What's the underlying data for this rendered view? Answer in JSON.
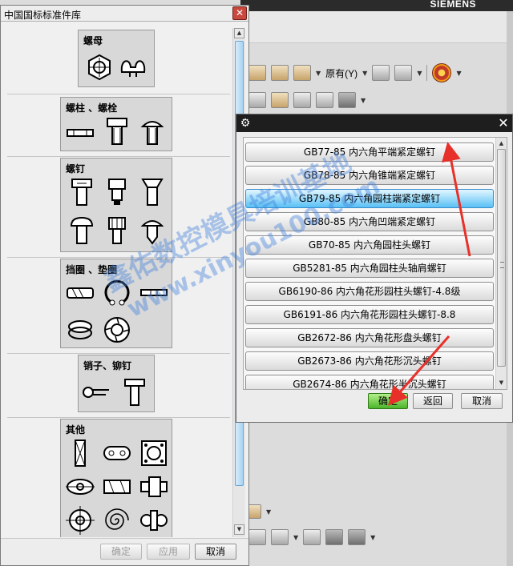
{
  "background": {
    "brand": "SIEMENS",
    "menu_label": "原有(Y)"
  },
  "library_panel": {
    "title": "中国国标标准件库",
    "categories": [
      {
        "label": "螺母",
        "icons": [
          "hex-nut-icon",
          "wing-nut-icon"
        ]
      },
      {
        "label": "螺柱 、螺栓",
        "icons": [
          "stud-icon",
          "hex-bolt-icon",
          "round-head-bolt-icon"
        ]
      },
      {
        "label": "螺钉",
        "icons": [
          "slotted-screw-icon",
          "cheese-head-screw-icon",
          "countersunk-screw-icon",
          "pan-head-screw-icon",
          "knurled-screw-icon",
          "tapping-screw-icon"
        ]
      },
      {
        "label": "挡圈 、垫圈",
        "icons": [
          "retaining-ring-side-icon",
          "circlip-icon",
          "flat-washer-icon",
          "spring-washer-icon",
          "lock-washer-icon"
        ]
      },
      {
        "label": "销子、铆钉",
        "icons": [
          "cotter-pin-icon",
          "rivet-icon"
        ]
      },
      {
        "label": "其他",
        "icons": [
          "key-icon",
          "plate-icon",
          "flange-icon",
          "spacer-icon",
          "clamp-icon",
          "coupling-icon",
          "cross-target-icon",
          "spiral-icon",
          "chain-icon"
        ]
      }
    ],
    "buttons": {
      "ok": "确定",
      "apply": "应用",
      "cancel": "取消"
    }
  },
  "selection_dialog": {
    "items": [
      "GB77-85 内六角平端紧定螺钉",
      "GB78-85 内六角锥端紧定螺钉",
      "GB79-85 内六角园柱端紧定螺钉",
      "GB80-85 内六角凹端紧定螺钉",
      "GB70-85 内六角园柱头螺钉",
      "GB5281-85 内六角园柱头轴肩螺钉",
      "GB6190-86 内六角花形园柱头螺钉-4.8级",
      "GB6191-86 内六角花形园柱头螺钉-8.8",
      "GB2672-86 内六角花形盘头螺钉",
      "GB2673-86 内六角花形沉头螺钉",
      "GB2674-86 内六角花形半沉头螺钉"
    ],
    "selected_index": 2,
    "buttons": {
      "ok": "确定",
      "back": "返回",
      "cancel": "取消"
    }
  },
  "watermark": {
    "line1": "鑫佑数控模具培训基地",
    "line2": "www.xinyou100.com"
  },
  "colors": {
    "selected_item": "#58c0f5",
    "ok_button": "#4ab42a",
    "annotation_arrow": "#e8302a"
  }
}
